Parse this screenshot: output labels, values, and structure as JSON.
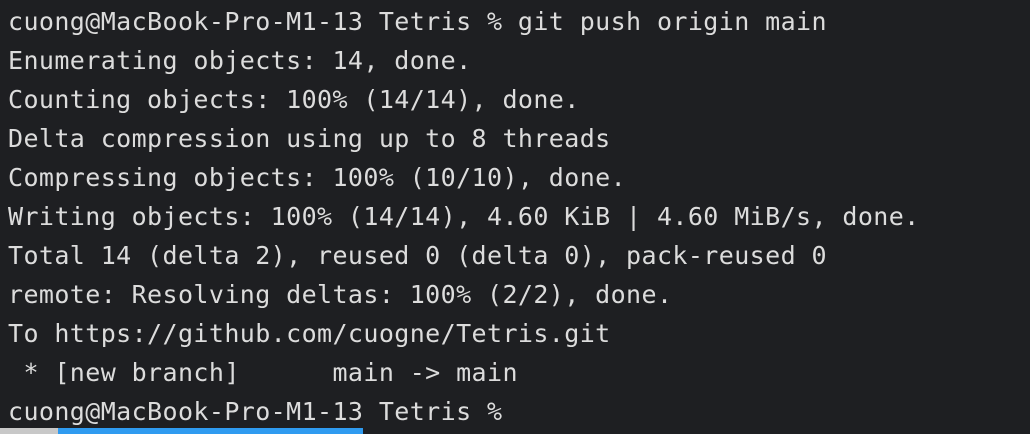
{
  "terminal": {
    "lines": [
      "cuong@MacBook-Pro-M1-13 Tetris % git push origin main",
      "Enumerating objects: 14, done.",
      "Counting objects: 100% (14/14), done.",
      "Delta compression using up to 8 threads",
      "Compressing objects: 100% (10/10), done.",
      "Writing objects: 100% (14/14), 4.60 KiB | 4.60 MiB/s, done.",
      "Total 14 (delta 2), reused 0 (delta 0), pack-reused 0",
      "remote: Resolving deltas: 100% (2/2), done.",
      "To https://github.com/cuogne/Tetris.git",
      " * [new branch]      main -> main",
      "cuong@MacBook-Pro-M1-13 Tetris %"
    ]
  },
  "colors": {
    "background": "#1e1f22",
    "text": "#dcdcdc",
    "accent_blue": "#2f9bf0"
  }
}
